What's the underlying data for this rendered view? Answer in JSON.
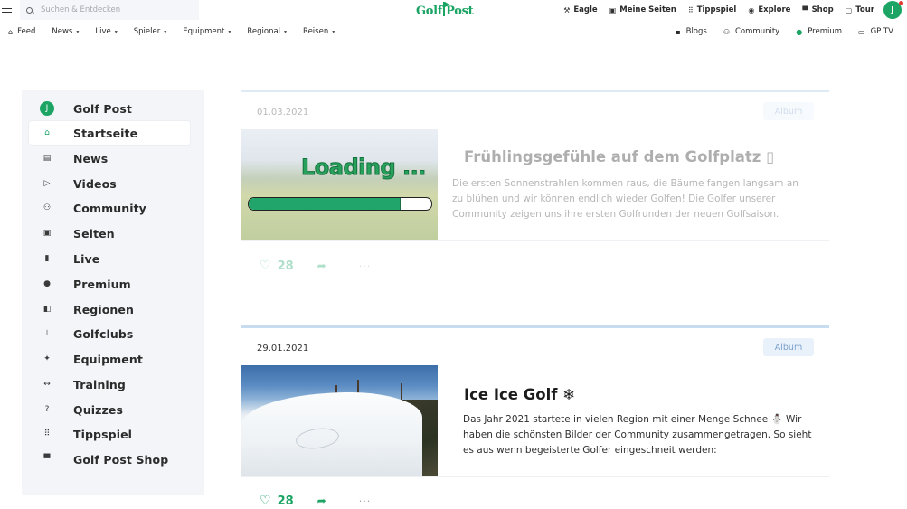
{
  "header": {
    "search_placeholder": "Suchen & Entdecken",
    "logo_left": "Golf",
    "logo_right": "Post",
    "nav": [
      {
        "icon": "wrench-icon",
        "glyph": "⚒",
        "label": "Eagle"
      },
      {
        "icon": "pages-icon",
        "glyph": "▣",
        "label": "Meine Seiten"
      },
      {
        "icon": "grid-icon",
        "glyph": "⠿",
        "label": "Tippspiel"
      },
      {
        "icon": "compass-icon",
        "glyph": "◉",
        "label": "Explore"
      },
      {
        "icon": "shop-icon",
        "glyph": "▀",
        "label": "Shop"
      },
      {
        "icon": "calendar-icon",
        "glyph": "▢",
        "label": "Tour"
      }
    ],
    "avatar_letter": "J"
  },
  "subnav": {
    "left": [
      {
        "label": "Feed",
        "glyph": "⌂",
        "has_caret": false
      },
      {
        "label": "News",
        "has_caret": true
      },
      {
        "label": "Live",
        "has_caret": true
      },
      {
        "label": "Spieler",
        "has_caret": true
      },
      {
        "label": "Equipment",
        "has_caret": true
      },
      {
        "label": "Regional",
        "has_caret": true
      },
      {
        "label": "Reisen",
        "has_caret": true
      }
    ],
    "right": [
      {
        "label": "Blogs",
        "icon": "blog-icon",
        "glyph": "▪"
      },
      {
        "label": "Community",
        "icon": "community-icon",
        "glyph": "⚇"
      },
      {
        "label": "Premium",
        "icon": "premium-icon",
        "glyph": "●"
      },
      {
        "label": "GP TV",
        "icon": "tv-icon",
        "glyph": "▭"
      }
    ],
    "caret": "▾"
  },
  "sidebar": {
    "brand": {
      "label": "Golf Post",
      "glyph": "J"
    },
    "items": [
      {
        "label": "Startseite",
        "icon": "home-icon",
        "glyph": "⌂",
        "active": true
      },
      {
        "label": "News",
        "icon": "news-icon",
        "glyph": "▤"
      },
      {
        "label": "Videos",
        "icon": "video-icon",
        "glyph": "▷"
      },
      {
        "label": "Community",
        "icon": "community-icon",
        "glyph": "⚇"
      },
      {
        "label": "Seiten",
        "icon": "pages-icon",
        "glyph": "▣"
      },
      {
        "label": "Live",
        "icon": "live-icon",
        "glyph": "▮"
      },
      {
        "label": "Premium",
        "icon": "premium-icon",
        "glyph": "●"
      },
      {
        "label": "Regionen",
        "icon": "map-icon",
        "glyph": "◧"
      },
      {
        "label": "Golfclubs",
        "icon": "golfclub-icon",
        "glyph": "⊥"
      },
      {
        "label": "Equipment",
        "icon": "equipment-icon",
        "glyph": "✦"
      },
      {
        "label": "Training",
        "icon": "training-icon",
        "glyph": "↔"
      },
      {
        "label": "Quizzes",
        "icon": "quiz-icon",
        "glyph": "?"
      },
      {
        "label": "Tippspiel",
        "icon": "grid-icon",
        "glyph": "⠿"
      },
      {
        "label": "Golf Post Shop",
        "icon": "cart-icon",
        "glyph": "▀"
      }
    ]
  },
  "feed": {
    "posts": [
      {
        "date": "01.03.2021",
        "badge": "Album",
        "title": "Frühlingsgefühle auf dem Golfplatz ▯",
        "excerpt": "Die ersten Sonnenstrahlen kommen raus, die Bäume fangen langsam an zu blühen und wir können endlich wieder Golfen! Die Golfer unserer Community zeigen uns ihre ersten Golfrunden der neuen Golfsaison.",
        "likes": "28",
        "loading_text": "Loading ...",
        "loading_progress": 0.83
      },
      {
        "date": "29.01.2021",
        "badge": "Album",
        "title": "Ice Ice Golf ❄",
        "excerpt": "Das Jahr 2021 startete in vielen Region mit einer Menge Schnee ⛄ Wir haben die schönsten Bilder der Community zusammengetragen. So sieht es aus wenn begeisterte Golfer eingeschneit werden:",
        "likes": "28"
      }
    ],
    "heart_glyph": "♡",
    "share_glyph": "➦",
    "more_glyph": "···"
  },
  "colors": {
    "brand_green": "#1ba464",
    "badge_bg": "#e9f1fb",
    "sidebar_bg": "#f3f5f9"
  }
}
